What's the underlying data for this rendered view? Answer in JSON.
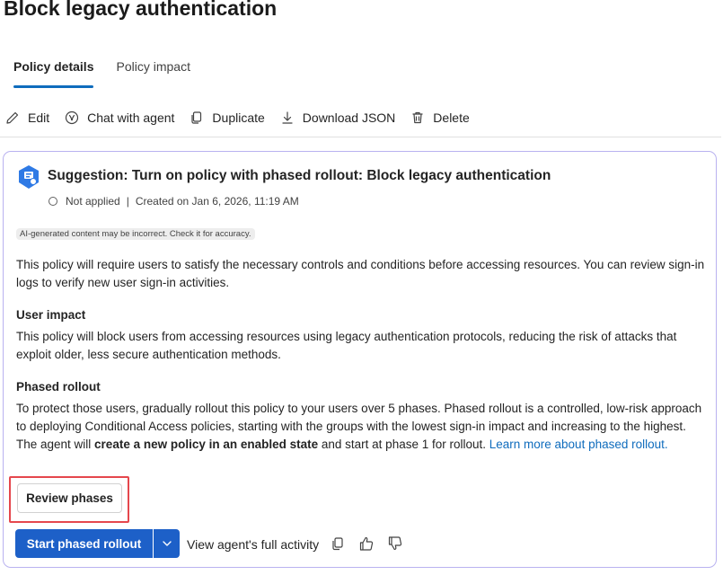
{
  "page": {
    "title": "Block legacy authentication"
  },
  "tabs": [
    {
      "label": "Policy details",
      "active": true
    },
    {
      "label": "Policy impact",
      "active": false
    }
  ],
  "toolbar": {
    "edit": "Edit",
    "chat": "Chat with agent",
    "duplicate": "Duplicate",
    "download": "Download JSON",
    "delete": "Delete"
  },
  "suggestion": {
    "title": "Suggestion: Turn on policy with phased rollout: Block legacy authentication",
    "status": "Not applied",
    "separator": "|",
    "created": "Created on Jan 6, 2026, 11:19 AM",
    "ai_notice": "AI-generated content may be incorrect. Check it for accuracy.",
    "intro": "This policy will require users to satisfy the necessary controls and conditions before accessing resources. You can review sign-in logs to verify new user sign-in activities.",
    "user_impact_heading": "User impact",
    "user_impact_text": "This policy will block users from accessing resources using legacy authentication protocols, reducing the risk of attacks that exploit older, less secure authentication methods.",
    "phased_heading": "Phased rollout",
    "phased_text_1": "To protect those users, gradually rollout this policy to your users over 5 phases. Phased rollout is a controlled, low-risk approach to deploying Conditional Access policies, starting with the groups with the lowest sign-in impact and increasing to the highest. The agent will ",
    "phased_text_bold": "create a new policy in an enabled state",
    "phased_text_2": " and start at phase 1 for rollout. ",
    "learn_more": "Learn more about phased rollout."
  },
  "actions": {
    "review_phases": "Review phases",
    "start_rollout": "Start phased rollout",
    "view_activity": "View agent's full activity"
  },
  "icons": [
    "edit-icon",
    "chat-agent-icon",
    "duplicate-icon",
    "download-icon",
    "delete-icon",
    "suggestion-icon",
    "chevron-down-icon",
    "copy-icon",
    "thumbs-up-icon",
    "thumbs-down-icon"
  ],
  "colors": {
    "accent": "#1d60c8",
    "link": "#0f6cbd",
    "card_border": "#b9b2f0",
    "highlight": "#e5474d"
  }
}
